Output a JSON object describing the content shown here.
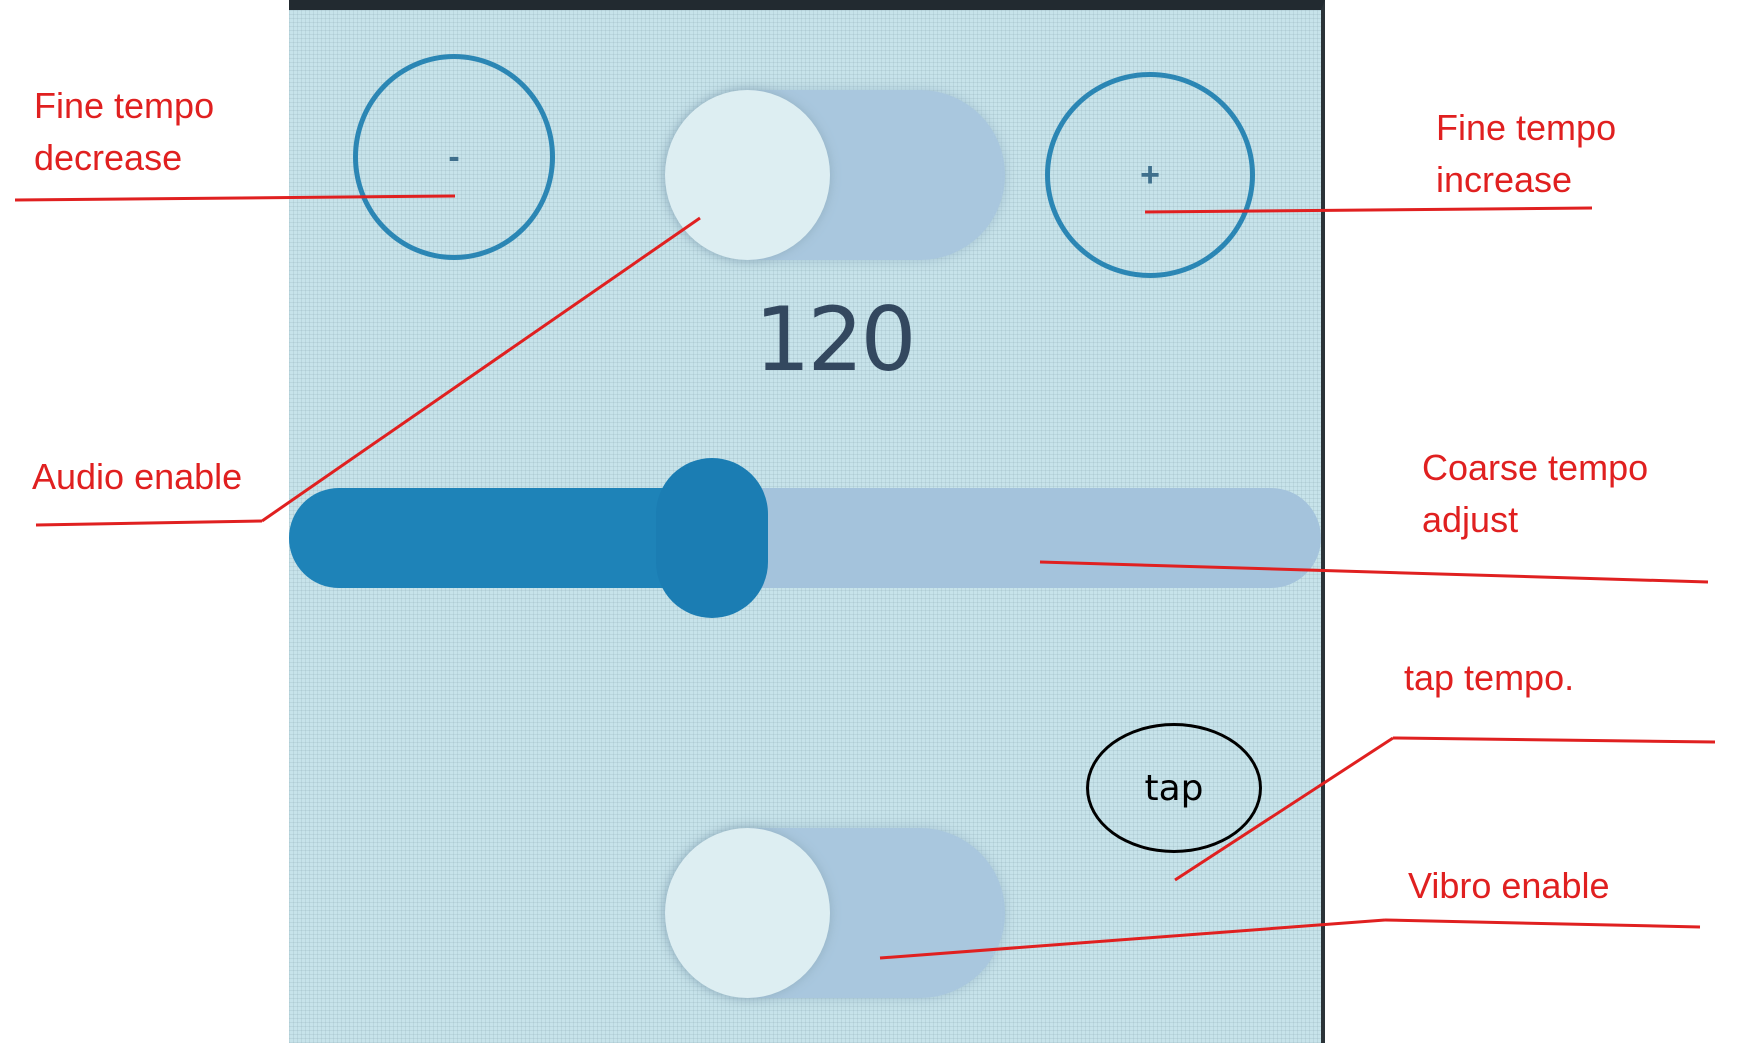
{
  "fine_decrease": {
    "symbol": "-"
  },
  "fine_increase": {
    "symbol": "+"
  },
  "audio_toggle": {
    "on": false
  },
  "tempo": {
    "value": "120"
  },
  "coarse_slider": {
    "fraction": 0.41
  },
  "tap_button": {
    "label": "tap"
  },
  "vibro_toggle": {
    "on": false
  },
  "annotations": {
    "fine_decrease": "Fine tempo\ndecrease",
    "fine_increase": "Fine tempo\nincrease",
    "audio_enable": "Audio enable",
    "coarse_adjust": "Coarse tempo\nadjust",
    "tap_tempo": "tap tempo.",
    "vibro_enable": "Vibro enable"
  },
  "colors": {
    "screen_bg": "#c7e3ea",
    "accent": "#1e83b8",
    "annotation": "#e02020"
  }
}
